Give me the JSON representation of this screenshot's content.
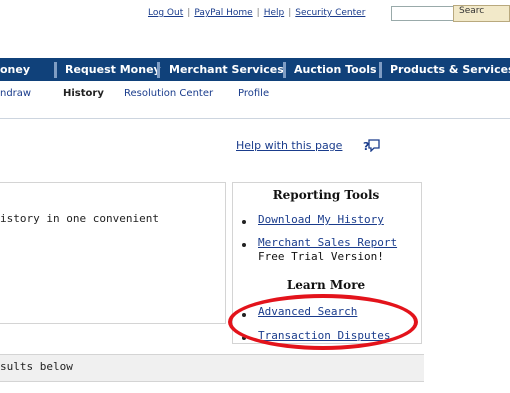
{
  "toplinks": {
    "logout": "Log Out",
    "home": "PayPal Home",
    "help": "Help",
    "security": "Security Center",
    "sep": "|"
  },
  "search": {
    "button_label": "Searc",
    "input_value": ""
  },
  "nav": {
    "tabs": [
      "oney",
      "Request Money",
      "Merchant Services",
      "Auction Tools",
      "Products & Services"
    ],
    "background": "#10417a"
  },
  "subnav": {
    "items": [
      "ndraw",
      "History",
      "Resolution Center",
      "Profile"
    ],
    "active": "History"
  },
  "help": {
    "link": "Help with this page",
    "icon": "help-popup-icon"
  },
  "left_box": {
    "text": "istory in one convenient"
  },
  "reporting": {
    "title": "Reporting Tools",
    "links": [
      "Download My History",
      "Merchant Sales Report"
    ],
    "note": "Free Trial Version!"
  },
  "learn_more": {
    "title": "Learn More",
    "links": [
      "Advanced Search",
      "Transaction Disputes"
    ]
  },
  "results": {
    "text": "sults below"
  },
  "highlight": {
    "color": "#e3131b",
    "target": "Advanced Search"
  }
}
